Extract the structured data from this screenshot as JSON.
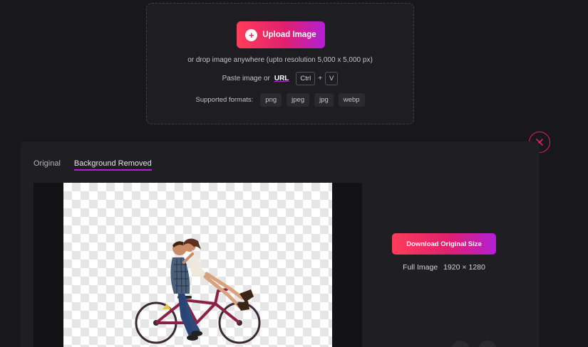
{
  "upload": {
    "button_label": "Upload Image",
    "drop_hint": "or drop image anywhere (upto resolution 5,000 x 5,000 px)",
    "paste_prefix": "Paste image or",
    "url_label": "URL",
    "key_ctrl": "Ctrl",
    "key_plus": "+",
    "key_v": "V",
    "formats_label": "Supported formats:",
    "formats": [
      "png",
      "jpeg",
      "jpg",
      "webp"
    ]
  },
  "result": {
    "tabs": [
      {
        "label": "Original",
        "active": false
      },
      {
        "label": "Background Removed",
        "active": true
      }
    ],
    "download_label": "Download Original Size",
    "size_label": "Full Image",
    "size_value": "1920 × 1280"
  },
  "colors": {
    "accent_start": "#ff3d5a",
    "accent_end": "#b21fd6",
    "background": "#18181b"
  }
}
